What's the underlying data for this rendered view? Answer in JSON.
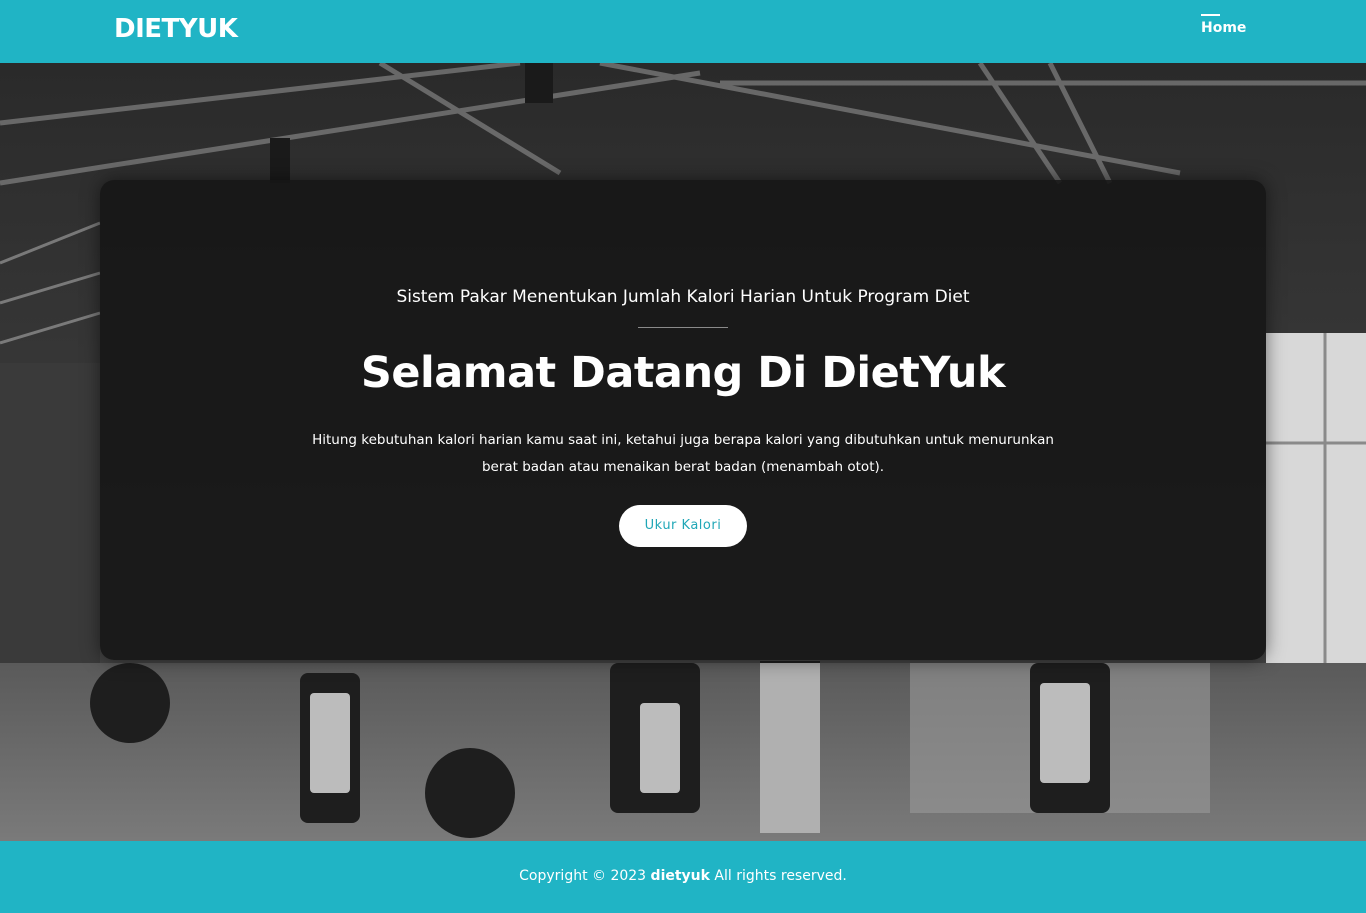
{
  "navbar": {
    "brand": "DIETYUK",
    "links": [
      {
        "label": "Home",
        "active": true
      }
    ]
  },
  "hero": {
    "subtitle": "Sistem Pakar Menentukan Jumlah Kalori Harian Untuk Program Diet",
    "headline": "Selamat Datang Di DietYuk",
    "description": "Hitung kebutuhan kalori harian kamu saat ini, ketahui juga berapa kalori yang dibutuhkan untuk menurunkan berat badan atau menaikan berat badan (menambah otot).",
    "cta_label": "Ukur Kalori"
  },
  "footer": {
    "prefix": "Copyright © 2023",
    "brand": "dietyuk",
    "suffix": "All rights reserved."
  },
  "colors": {
    "accent": "#20b4c5",
    "card_bg": "#161616",
    "cta_text": "#20a7b7"
  }
}
